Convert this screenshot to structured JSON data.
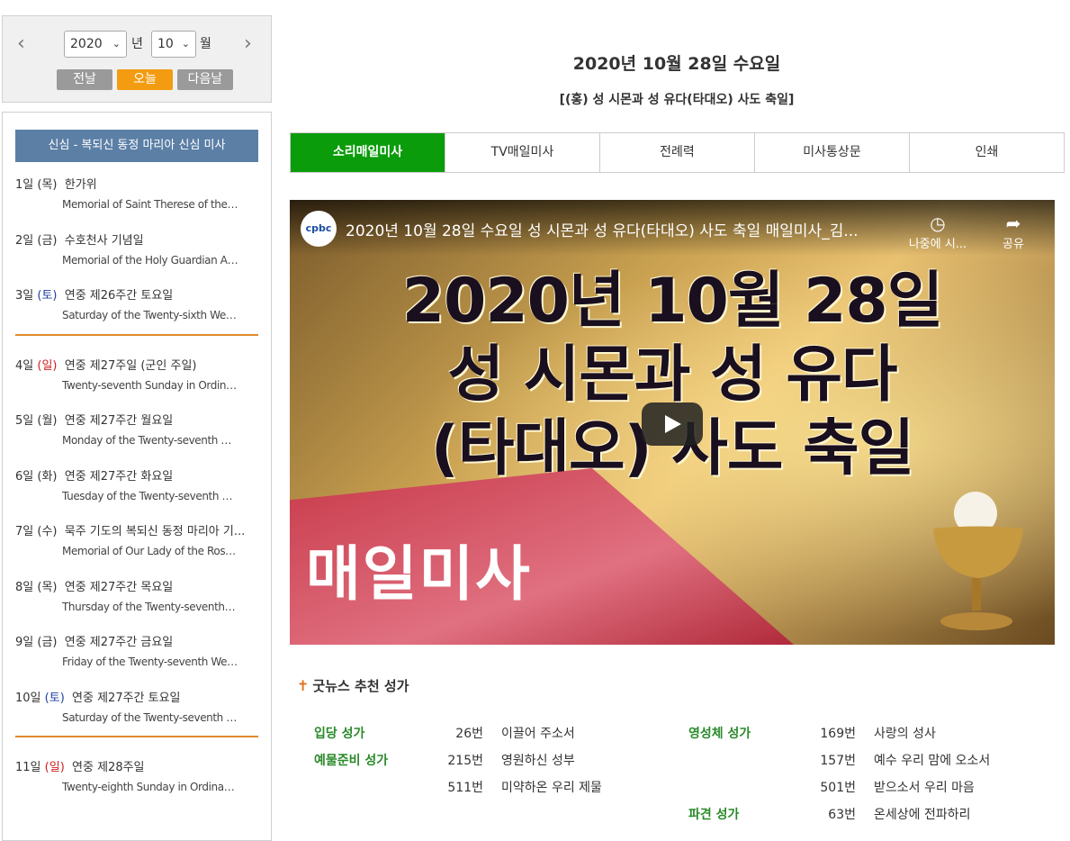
{
  "date_nav": {
    "prev_icon": "chevron-left-icon",
    "next_icon": "chevron-right-icon",
    "year": "2020",
    "year_unit": "년",
    "month": "10",
    "month_unit": "월",
    "prev_day": "전날",
    "today": "오늘",
    "next_day": "다음날"
  },
  "list": {
    "header": "신심 - 복되신 동정 마리아 신심 미사",
    "days": [
      {
        "day": "1일",
        "dow": "(목)",
        "title": "한가위",
        "sub": "Memorial of Saint Therese of the Child Jesus"
      },
      {
        "day": "2일",
        "dow": "(금)",
        "title": "수호천사 기념일",
        "sub": "Memorial of the Holy Guardian Angels"
      },
      {
        "day": "3일",
        "dow": "(토)",
        "title": "연중 제26주간 토요일",
        "sub": "Saturday of the Twenty-sixth Week in Ordinary Time"
      },
      {
        "day": "4일",
        "dow": "(일)",
        "title": "연중 제27주일 (군인 주일)",
        "sub": "Twenty-seventh Sunday in Ordinary Time"
      },
      {
        "day": "5일",
        "dow": "(월)",
        "title": "연중 제27주간 월요일",
        "sub": "Monday of the Twenty-seventh Week in Ordinary Time"
      },
      {
        "day": "6일",
        "dow": "(화)",
        "title": "연중 제27주간 화요일",
        "sub": "Tuesday of the Twenty-seventh Week in Ordinary Time"
      },
      {
        "day": "7일",
        "dow": "(수)",
        "title": "묵주 기도의 복되신 동정 마리아 기...",
        "sub": "Memorial of Our Lady of the Rosary"
      },
      {
        "day": "8일",
        "dow": "(목)",
        "title": "연중 제27주간 목요일",
        "sub": "Thursday of the Twenty-seventh Week in Ordinary Time"
      },
      {
        "day": "9일",
        "dow": "(금)",
        "title": "연중 제27주간 금요일",
        "sub": "Friday of the Twenty-seventh Week in Ordinary Time"
      },
      {
        "day": "10일",
        "dow": "(토)",
        "title": "연중 제27주간 토요일",
        "sub": "Saturday of the Twenty-seventh Week in Ordinary Time"
      },
      {
        "day": "11일",
        "dow": "(일)",
        "title": "연중 제28주일",
        "sub": "Twenty-eighth Sunday in Ordinary Time"
      }
    ]
  },
  "main": {
    "date_title": "2020년 10월 28일 수요일",
    "feast": "[(홍) 성 시몬과 성 유다(타대오) 사도 축일]",
    "tabs": [
      "소리매일미사",
      "TV매일미사",
      "전례력",
      "미사통상문",
      "인쇄"
    ]
  },
  "video": {
    "logo": "cpbc",
    "title": "2020년 10월 28일 수요일 성 시몬과 성 유다(타대오) 사도 축일 매일미사_김...",
    "watch_later": "나중에 시...",
    "share": "공유",
    "big_line1": "2020년 10월 28일",
    "big_line2": "성 시몬과 성 유다",
    "big_line3": "(타대오) 사도 축일",
    "daily_label": "매일미사",
    "play_icon": "play-icon"
  },
  "hymns": {
    "header": "굿뉴스 추천 성가",
    "left": [
      {
        "label": "입당 성가",
        "num": "26번",
        "title": "이끌어 주소서"
      },
      {
        "label": "예물준비 성가",
        "num": "215번",
        "title": "영원하신 성부"
      },
      {
        "label": "",
        "num": "511번",
        "title": "미약하온 우리 제물"
      }
    ],
    "right": [
      {
        "label": "영성체 성가",
        "num": "169번",
        "title": "사랑의 성사"
      },
      {
        "label": "",
        "num": "157번",
        "title": "예수 우리 맘에 오소서"
      },
      {
        "label": "",
        "num": "501번",
        "title": "받으소서 우리 마음"
      },
      {
        "label": "파견 성가",
        "num": "63번",
        "title": "온세상에 전파하리"
      }
    ]
  },
  "colors": {
    "tab_active": "#0a9c0a",
    "today_button": "#f39c12",
    "list_header": "#5c7fa6",
    "separator": "#e08a2e"
  }
}
